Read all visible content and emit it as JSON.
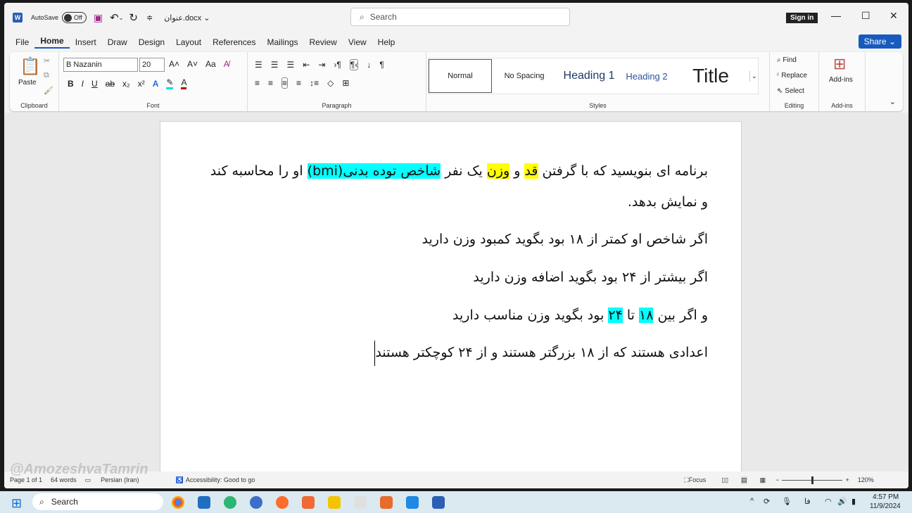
{
  "titlebar": {
    "autosave_label": "AutoSave",
    "autosave_state": "Off",
    "filename": "عنوان.docx",
    "search_placeholder": "Search",
    "signin": "Sign in"
  },
  "menu": {
    "tabs": [
      "File",
      "Home",
      "Insert",
      "Draw",
      "Design",
      "Layout",
      "References",
      "Mailings",
      "Review",
      "View",
      "Help"
    ],
    "active": "Home",
    "share": "Share"
  },
  "ribbon": {
    "clipboard": {
      "label": "Clipboard",
      "paste": "Paste"
    },
    "font": {
      "label": "Font",
      "name": "B Nazanin",
      "size": "20",
      "case": "Aa",
      "bold": "B",
      "italic": "I",
      "underline": "U",
      "strike": "ab",
      "sub": "x₂",
      "sup": "x²"
    },
    "paragraph": {
      "label": "Paragraph",
      "pilcrow": "¶"
    },
    "styles": {
      "label": "Styles",
      "items": [
        "Normal",
        "No Spacing",
        "Heading 1",
        "Heading 2",
        "Title"
      ]
    },
    "editing": {
      "label": "Editing",
      "find": "Find",
      "replace": "Replace",
      "select": "Select"
    },
    "addins": {
      "label": "Add-ins",
      "button": "Add-ins"
    }
  },
  "colors": {
    "accent": "#185abd",
    "highlight_yellow": "#ffff00",
    "highlight_cyan": "#00ffff"
  },
  "document": {
    "p1": {
      "a": "برنامه ای بنویسید که با گرفتن ",
      "b": "قد",
      "c": " و ",
      "d": "وزن",
      "e": " یک نفر ",
      "f": "شاخص توده بدنی(bmi)",
      "g": " او را محاسبه کند و نمایش بدهد."
    },
    "p2": "اگر شاخص او کمتر از ۱۸ بود بگوید کمبود وزن دارید",
    "p3": "اگر بیشتر از ۲۴ بود بگوید اضافه وزن دارید",
    "p4": {
      "a": "و اگر بین ",
      "b": "۱۸",
      "c": " تا ",
      "d": "۲۴",
      "e": " بود بگوید وزن مناسب دارید"
    },
    "p5": "اعدادی هستند که از ۱۸ بزرگتر هستند و از ۲۴ کوچکتر هستند"
  },
  "status": {
    "page": "Page 1 of 1",
    "words": "64 words",
    "language": "Persian (Iran)",
    "accessibility": "Accessibility: Good to go",
    "focus": "Focus",
    "zoom": "120%",
    "zoom_percent": 120
  },
  "taskbar": {
    "search": "Search",
    "time": "4:57 PM",
    "date": "11/9/2024",
    "lang": "فا"
  },
  "watermark": "@AmozeshvaTamrin"
}
